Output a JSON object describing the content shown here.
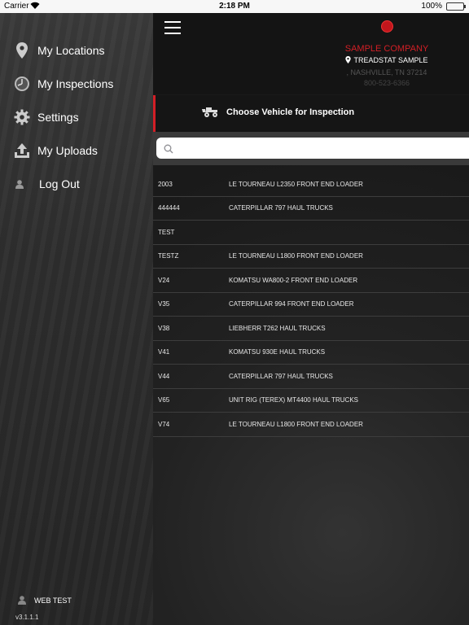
{
  "status_bar": {
    "carrier": "Carrier",
    "time": "2:18 PM",
    "battery": "100%"
  },
  "sidebar": {
    "items": [
      {
        "label": "My Locations",
        "icon": "location-pin-icon"
      },
      {
        "label": "My Inspections",
        "icon": "gauge-icon"
      },
      {
        "label": "Settings",
        "icon": "gear-icon"
      },
      {
        "label": "My Uploads",
        "icon": "upload-icon"
      },
      {
        "label": "Log Out",
        "icon": "user-icon"
      }
    ],
    "user": "WEB TEST",
    "version": "v3.1.1.1"
  },
  "header": {
    "company": "SAMPLE COMPANY",
    "location": "TREADSTAT SAMPLE",
    "address": ", NASHVILLE, TN 37214",
    "phone": "800-523-6366"
  },
  "title": "Choose Vehicle for Inspection",
  "search": {
    "placeholder": ""
  },
  "vehicles": [
    {
      "id": "2003",
      "description": "LE TOURNEAU L2350 FRONT END LOADER"
    },
    {
      "id": "444444",
      "description": "CATERPILLAR 797 HAUL TRUCKS"
    },
    {
      "id": "TEST",
      "description": ""
    },
    {
      "id": "TESTZ",
      "description": "LE TOURNEAU L1800 FRONT END LOADER"
    },
    {
      "id": "V24",
      "description": "KOMATSU WA800-2 FRONT END LOADER"
    },
    {
      "id": "V35",
      "description": "CATERPILLAR 994 FRONT END LOADER"
    },
    {
      "id": "V38",
      "description": "LIEBHERR T262 HAUL TRUCKS"
    },
    {
      "id": "V41",
      "description": "KOMATSU 930E HAUL TRUCKS"
    },
    {
      "id": "V44",
      "description": "CATERPILLAR 797 HAUL TRUCKS"
    },
    {
      "id": "V65",
      "description": "UNIT RIG (TEREX) MT4400 HAUL TRUCKS"
    },
    {
      "id": "V74",
      "description": "LE TOURNEAU L1800 FRONT END LOADER"
    }
  ],
  "colors": {
    "accent": "#d21f26",
    "background": "#1b1b1b"
  }
}
